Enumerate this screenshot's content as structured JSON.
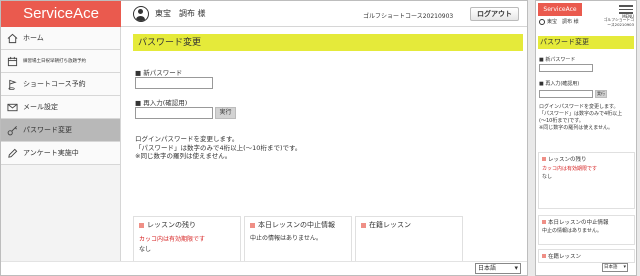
{
  "brand": "ServiceAce",
  "user": {
    "name": "東宝　調布 様",
    "course": "ゴルフショートコース20210903"
  },
  "logout_label": "ログアウト",
  "sidebar": {
    "items": [
      {
        "label": "ホーム",
        "icon": "home-icon"
      },
      {
        "label": "練習場土日祝早朝打ち放題予約",
        "icon": "calendar-icon"
      },
      {
        "label": "ショートコース予約",
        "icon": "flag-icon"
      },
      {
        "label": "メール設定",
        "icon": "mail-icon"
      },
      {
        "label": "パスワード変更",
        "icon": "key-icon"
      },
      {
        "label": "アンケート実施中",
        "icon": "pencil-icon"
      }
    ]
  },
  "page_title": "パスワード変更",
  "form": {
    "new_password_label": "■ 新パスワード",
    "confirm_label": "■ 再入力(確認用)",
    "execute_label": "実行",
    "new_password_value": "",
    "confirm_value": ""
  },
  "description": [
    "ログインパスワードを変更します。",
    "「パスワード」は数字のみで4桁以上(〜10桁まで)です。",
    "※同じ数字の羅列は使えません。"
  ],
  "cards": {
    "lessons_left": {
      "title": "レッスンの残り",
      "note": "カッコ内は有効期限です",
      "value": "なし"
    },
    "cancel_info": {
      "title": "本日レッスンの中止情報",
      "value": "中止の情報はありません。"
    },
    "enrolled": {
      "title": "在籍レッスン"
    }
  },
  "mobile": {
    "menu_label": "MENU",
    "course_lines": [
      "ゴルフショートコ",
      "ース20210903"
    ],
    "user_name": "東宝　調布 様",
    "description": [
      "ログインパスワードを変更します。",
      "「パスワード」は数字のみで4桁以上",
      "(〜10桁まで)です。",
      "※同じ数字の羅列は使えません。"
    ]
  },
  "language": {
    "selected": "日本語"
  },
  "colors": {
    "brand": "#ea5a4e",
    "heading": "#e5ea3a",
    "alert": "#d61f1f"
  }
}
